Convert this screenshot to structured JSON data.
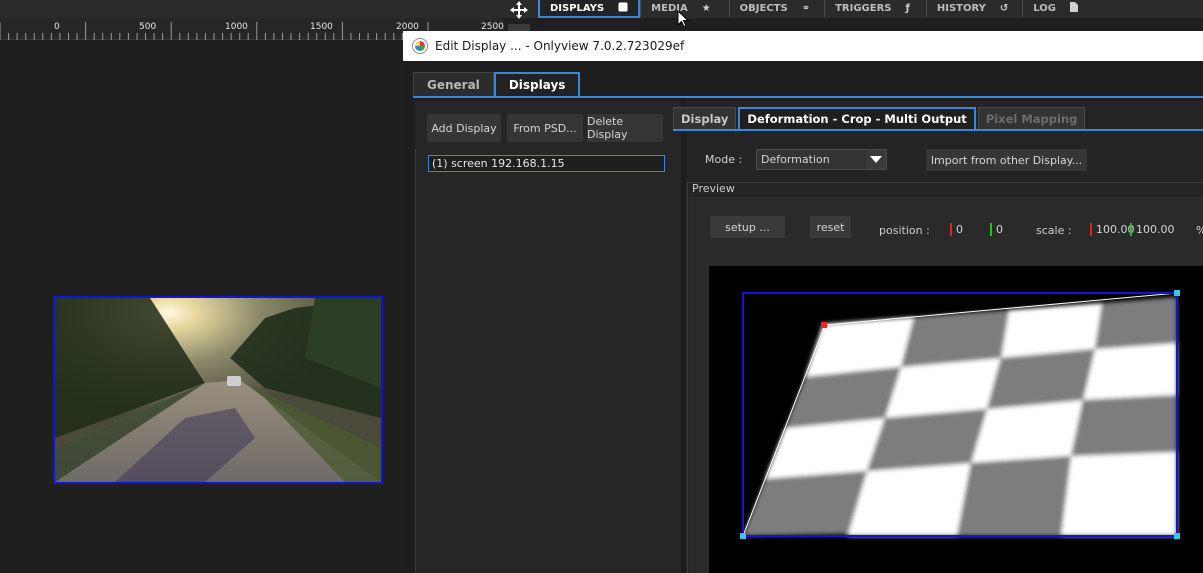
{
  "ruler": {
    "labels": [
      "0",
      "500",
      "1000",
      "1500",
      "2000",
      "2500"
    ]
  },
  "nav": {
    "tabs": [
      {
        "label": "DISPLAYS",
        "icon": "square-icon",
        "active": true
      },
      {
        "label": "MEDIA",
        "icon": "star-icon",
        "active": false
      },
      {
        "label": "OBJECTS",
        "icon": "objects-icon",
        "active": false
      },
      {
        "label": "TRIGGERS",
        "icon": "trigger-icon",
        "active": false
      },
      {
        "label": "HISTORY",
        "icon": "history-icon",
        "active": false
      },
      {
        "label": "LOG",
        "icon": "document-icon",
        "active": false
      }
    ]
  },
  "dialog": {
    "title": "Edit Display ... - Onlyview  7.0.2.723029ef",
    "main_tabs": [
      "General",
      "Displays"
    ],
    "buttons": {
      "add": "Add Display",
      "from_psd": "From PSD...",
      "delete": "Delete Display"
    },
    "display_list": [
      "(1)  screen  192.168.1.15"
    ],
    "sub_tabs": [
      "Display",
      "Deformation - Crop - Multi Output",
      "Pixel Mapping"
    ],
    "mode": {
      "label": "Mode :",
      "value": "Deformation"
    },
    "import_button": "Import from other Display...",
    "preview": {
      "label": "Preview",
      "setup_button": "setup ...",
      "reset_button": "reset",
      "position_label": "position :",
      "position_x": "0",
      "position_y": "0",
      "scale_label": "scale :",
      "scale_x": "100.00",
      "scale_y": "100.00",
      "unit": "%"
    }
  },
  "colors": {
    "accent": "#3b86d6",
    "selection": "#1212d8",
    "handle": "#35c8f0",
    "corner_handle": "#ff2020"
  }
}
